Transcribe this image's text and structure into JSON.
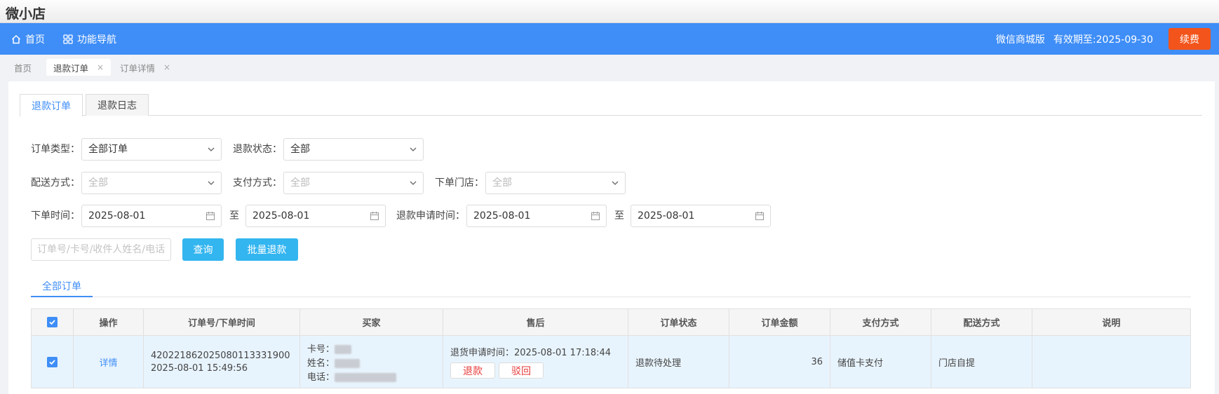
{
  "app": {
    "title": "微小店"
  },
  "topnav": {
    "home_label": "首页",
    "func_nav_label": "功能导航",
    "edition": "微信商城版",
    "expiry": "有效期至:2025-09-30",
    "renew_label": "续费"
  },
  "page_tabs": [
    {
      "label": "首页"
    },
    {
      "label": "退款订单",
      "close": "×"
    },
    {
      "label": "订单详情",
      "close": "×"
    }
  ],
  "sub_tabs": [
    {
      "label": "退款订单"
    },
    {
      "label": "退款日志"
    }
  ],
  "filters": {
    "order_type": {
      "label": "订单类型：",
      "value": "全部订单"
    },
    "refund_status": {
      "label": "退款状态：",
      "value": "全部"
    },
    "delivery": {
      "label": "配送方式：",
      "value": "全部"
    },
    "payment": {
      "label": "支付方式：",
      "value": "全部"
    },
    "store": {
      "label": "下单门店：",
      "value": "全部"
    },
    "order_time": {
      "label": "下单时间：",
      "start": "2025-08-01",
      "sep": "至",
      "end": "2025-08-01"
    },
    "refund_time": {
      "label": "退款申请时间：",
      "start": "2025-08-01",
      "sep": "至",
      "end": "2025-08-01"
    },
    "search_placeholder": "订单号/卡号/收件人姓名/电话",
    "query_label": "查询",
    "batch_refund_label": "批量退款"
  },
  "order_tabs": [
    {
      "label": "全部订单"
    }
  ],
  "table": {
    "headers": [
      "操作",
      "订单号/下单时间",
      "买家",
      "售后",
      "订单状态",
      "订单金额",
      "支付方式",
      "配送方式",
      "说明"
    ],
    "rows": [
      {
        "action": "详情",
        "order_no": "420221862025080113331900",
        "order_time": "2025-08-01 15:49:56",
        "buyer_card": "卡号：",
        "buyer_name": "姓名：",
        "buyer_phone": "电话：",
        "aftersale_time": "退货申请时间：2025-08-01 17:18:44",
        "refund_btn": "退款",
        "reject_btn": "驳回",
        "status": "退款待处理",
        "amount": "36",
        "payment": "储值卡支付",
        "delivery": "门店自提",
        "note": ""
      }
    ]
  },
  "colors": {
    "nav_blue": "#3f8ef7",
    "renew_orange": "#f2541b",
    "button_cyan": "#33b5f0",
    "row_highlight": "#e8f4fd",
    "danger_red": "#e83a3a"
  }
}
